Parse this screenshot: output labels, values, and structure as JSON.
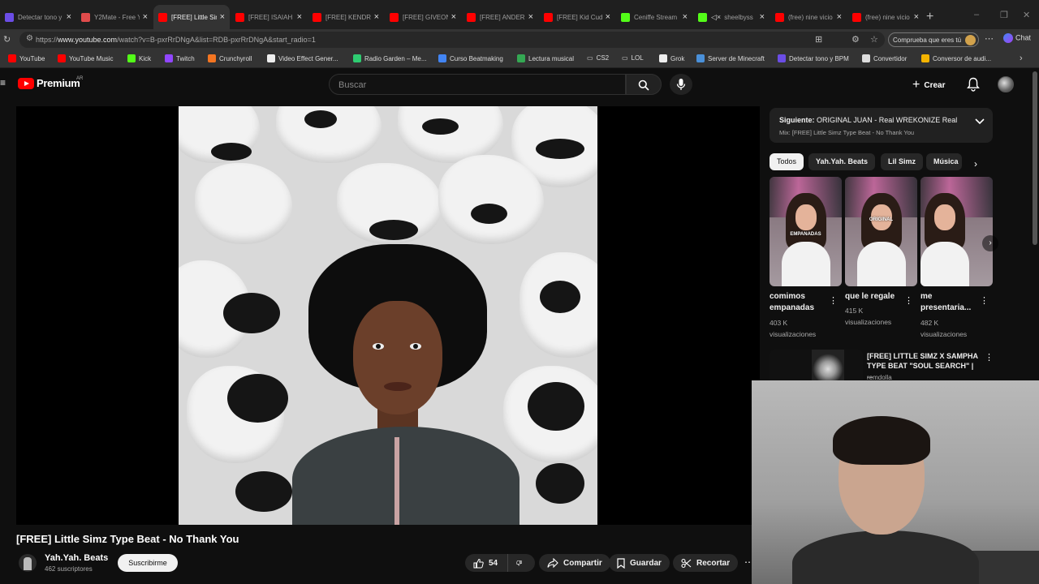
{
  "browser": {
    "tabs": [
      {
        "title": "Detectar tono y",
        "color": "#6b4de6"
      },
      {
        "title": "Y2Mate - Free Y",
        "color": "#e04b4b"
      },
      {
        "title": "[FREE] Little Sim",
        "color": "#ff0000"
      },
      {
        "title": "[FREE] ISAIAH R",
        "color": "#ff0000"
      },
      {
        "title": "[FREE] KENDRIC",
        "color": "#ff0000"
      },
      {
        "title": "[FREE] GIVEON",
        "color": "#ff0000"
      },
      {
        "title": "[FREE] ANDERS",
        "color": "#ff0000"
      },
      {
        "title": "[FREE] Kid Cudi",
        "color": "#ff0000"
      },
      {
        "title": "Ceniffe Stream",
        "color": "#53fc18"
      },
      {
        "title": "sheelbyss",
        "color": "#53fc18"
      },
      {
        "title": "(free) nine vicio",
        "color": "#ff0000"
      },
      {
        "title": "(free) nine vicio",
        "color": "#ff0000"
      }
    ],
    "url_prefix": "https://",
    "url_host": "www.youtube.com",
    "url_path": "/watch?v=B-pxrRrDNgA&list=RDB-pxrRrDNgA&start_radio=1",
    "profile_pill": "Comprueba que eres tú",
    "chat_label": "Chat",
    "bookmarks": [
      {
        "label": "YouTube",
        "color": "#ff0000"
      },
      {
        "label": "YouTube Music",
        "color": "#ff0000"
      },
      {
        "label": "Kick",
        "color": "#53fc18"
      },
      {
        "label": "Twitch",
        "color": "#9146ff"
      },
      {
        "label": "Crunchyroll",
        "color": "#f47521"
      },
      {
        "label": "Video Effect Gener...",
        "color": "#eeeeee"
      },
      {
        "label": "Radio Garden – Me...",
        "color": "#2ecc71"
      },
      {
        "label": "Curso Beatmaking",
        "color": "#4285f4"
      },
      {
        "label": "Lectura musical",
        "color": "#34a853"
      },
      {
        "label": "CS2",
        "color": "#cccccc"
      },
      {
        "label": "LOL",
        "color": "#cccccc"
      },
      {
        "label": "Grok",
        "color": "#eeeeee"
      },
      {
        "label": "Server de Minecraft",
        "color": "#4a90d9"
      },
      {
        "label": "Detectar tono y BPM",
        "color": "#6b4de6"
      },
      {
        "label": "Convertidor",
        "color": "#dddddd"
      },
      {
        "label": "Conversor de audi...",
        "color": "#f4b400"
      }
    ]
  },
  "youtube": {
    "logo_text": "Premium",
    "logo_region": "AR",
    "search_placeholder": "Buscar",
    "create_label": "Crear"
  },
  "video": {
    "title": "[FREE] Little Simz Type Beat - No Thank You",
    "channel": "Yah.Yah. Beats",
    "subscribers": "462 suscriptores",
    "subscribe_label": "Suscribirme",
    "likes": "54",
    "share_label": "Compartir",
    "save_label": "Guardar",
    "clip_label": "Recortar"
  },
  "sidebar": {
    "next_prefix": "Siguiente:",
    "next_title": "ORIGINAL JUAN - Real WREKONIZE Real",
    "mix_label": "Mix: [FREE] Little Simz Type Beat - No Thank You",
    "chips": [
      "Todos",
      "Yah.Yah. Beats",
      "Lil Simz",
      "Música"
    ],
    "shorts": [
      {
        "caption": "EMPANADAS",
        "title_1": "comimos",
        "title_2": "empanadas",
        "views_1": "403 K",
        "views_2": "visualizaciones"
      },
      {
        "caption": "ORIGINAL",
        "title_1": "que le regale",
        "title_2": "",
        "views_1": "415 K",
        "views_2": "visualizaciones"
      },
      {
        "caption": "",
        "title_1": "me",
        "title_2": "presentaria...",
        "views_1": "482 K",
        "views_2": "visualizaciones"
      }
    ],
    "rec": {
      "title_1": "[FREE] LITTLE SIMZ X SAMPHA",
      "title_2": "TYPE BEAT \"SOUL SEARCH\" | ...",
      "channel": "remdolla"
    }
  }
}
